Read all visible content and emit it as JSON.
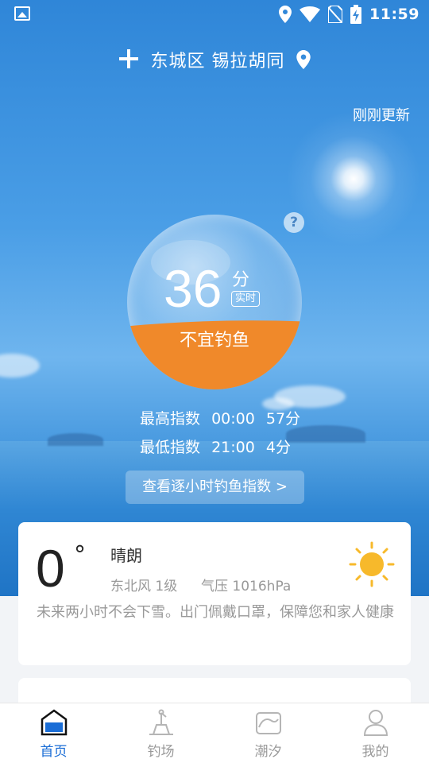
{
  "status_bar": {
    "time": "11:59",
    "icons": [
      "gallery-icon",
      "location-icon",
      "wifi-icon",
      "no-sim-icon",
      "battery-charging-icon"
    ]
  },
  "header": {
    "add_icon": "plus-icon",
    "location": "东城区 锡拉胡同",
    "location_icon": "location-pin-icon",
    "updated": "刚刚更新"
  },
  "fishing_index": {
    "score": "36",
    "unit": "分",
    "realtime_badge": "实时",
    "verdict": "不宜钓鱼",
    "help": "?",
    "fill_level": 0.38,
    "fill_color": "#f0892a",
    "max_label": "最高指数",
    "max_time": "00:00",
    "max_value": "57分",
    "min_label": "最低指数",
    "min_time": "21:00",
    "min_value": "4分",
    "hourly_button": "查看逐小时钓鱼指数 >"
  },
  "weather": {
    "temperature": "0",
    "degree_symbol": "°",
    "condition": "晴朗",
    "wind": "东北风  1级",
    "pressure": "气压  1016hPa",
    "forecast": "未来两小时不会下雪。出门佩戴口罩，保障您和家人健康",
    "icon": "sun-icon",
    "sun_color": "#f7b92b"
  },
  "bottom_nav": {
    "active_color": "#1a6dd6",
    "items": [
      {
        "label": "首页",
        "icon": "home-icon",
        "active": true
      },
      {
        "label": "钓场",
        "icon": "fishing-spot-icon",
        "active": false
      },
      {
        "label": "潮汐",
        "icon": "tide-icon",
        "active": false
      },
      {
        "label": "我的",
        "icon": "profile-icon",
        "active": false
      }
    ]
  }
}
